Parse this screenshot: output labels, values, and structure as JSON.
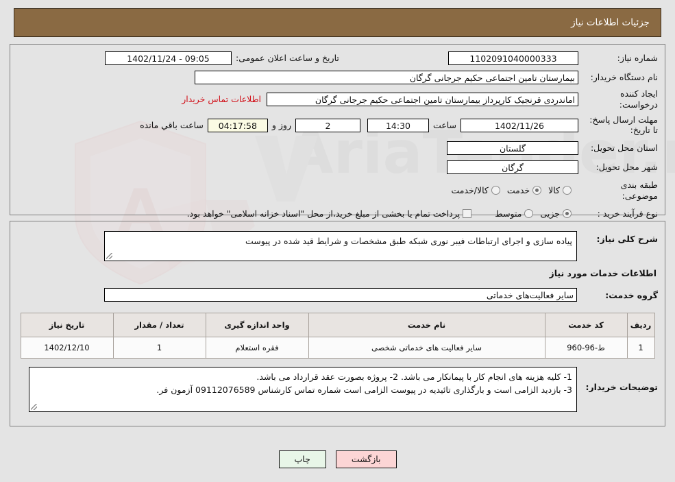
{
  "header": {
    "title": "جزئیات اطلاعات نیاز"
  },
  "watermark": {
    "text": "AriaTender.net"
  },
  "form": {
    "need_number_label": "شماره نیاز:",
    "need_number_value": "1102091040000333",
    "public_announce_label": "تاریخ و ساعت اعلان عمومی:",
    "public_announce_value": "09:05 - 1402/11/24",
    "buyer_org_label": "نام دستگاه خریدار:",
    "buyer_org_value": "بیمارستان تامین اجتماعی حکیم جرجانی گرگان",
    "creator_label": "ایجاد کننده درخواست:",
    "creator_value": "اماندردی قرنجیک کارپرداز بیمارستان تامین اجتماعی حکیم جرجانی گرگان",
    "contact_link": "اطلاعات تماس خریدار",
    "deadline_label": "مهلت ارسال پاسخ: تا تاریخ:",
    "deadline_date": "1402/11/26",
    "hour_label": "ساعت",
    "deadline_time": "14:30",
    "days_value": "2",
    "days_label": "روز و",
    "countdown_value": "04:17:58",
    "remaining_label": "ساعت باقي مانده",
    "province_label": "استان محل تحویل:",
    "province_value": "گلستان",
    "city_label": "شهر محل تحویل:",
    "city_value": "گرگان",
    "category_label": "طبقه بندی موضوعی:",
    "category_options": [
      "کالا",
      "خدمت",
      "کالا/خدمت"
    ],
    "category_selected": "خدمت",
    "process_label": "نوع فرآیند خرید :",
    "process_options": [
      "جزیی",
      "متوسط"
    ],
    "process_selected": "جزیی",
    "treasury_checkbox_label": "پرداخت تمام یا بخشی از مبلغ خرید،از محل \"اسناد خزانه اسلامی\" خواهد بود.",
    "treasury_checked": false
  },
  "summary": {
    "label": "شرح کلی نیاز:",
    "value": "پیاده سازی و اجرای ارتباطات فیبر نوری شبکه طبق مشخصات و شرایط قید شده در پیوست"
  },
  "services_section": {
    "heading": "اطلاعات خدمات مورد نیاز",
    "group_label": "گروه خدمت:",
    "group_value": "سایر فعالیت‌های خدماتی"
  },
  "items_table": {
    "columns": [
      "ردیف",
      "کد خدمت",
      "نام خدمت",
      "واحد اندازه گیری",
      "تعداد / مقدار",
      "تاریخ نیاز"
    ],
    "rows": [
      {
        "row": "1",
        "code": "ط-96-960",
        "name": "سایر فعالیت های خدماتی شخصی",
        "unit": "فقره استعلام",
        "qty": "1",
        "need_date": "1402/12/10"
      }
    ]
  },
  "buyer_notes": {
    "label": "توضیحات خریدار:",
    "line1": "1- کلیه هزینه های انجام کار با پیمانکار می باشد. 2- پروژه بصورت عقد قرارداد می باشد.",
    "line2": "3- بازدید الزامی است و بارگذاری تائیدیه در پیوست الزامی است شماره تماس کارشناس 09112076589 آزمون فر."
  },
  "footer": {
    "print_label": "چاپ",
    "back_label": "بازگشت"
  },
  "colors": {
    "header_bg": "#8a6a43",
    "link_red": "#d10f18",
    "page_bg": "#e4e4e4",
    "table_header_bg": "#e8e4e1",
    "print_btn_bg": "#e8f6e8",
    "back_btn_bg": "#fcd5d5",
    "countdown_bg": "#fbfbe4"
  }
}
